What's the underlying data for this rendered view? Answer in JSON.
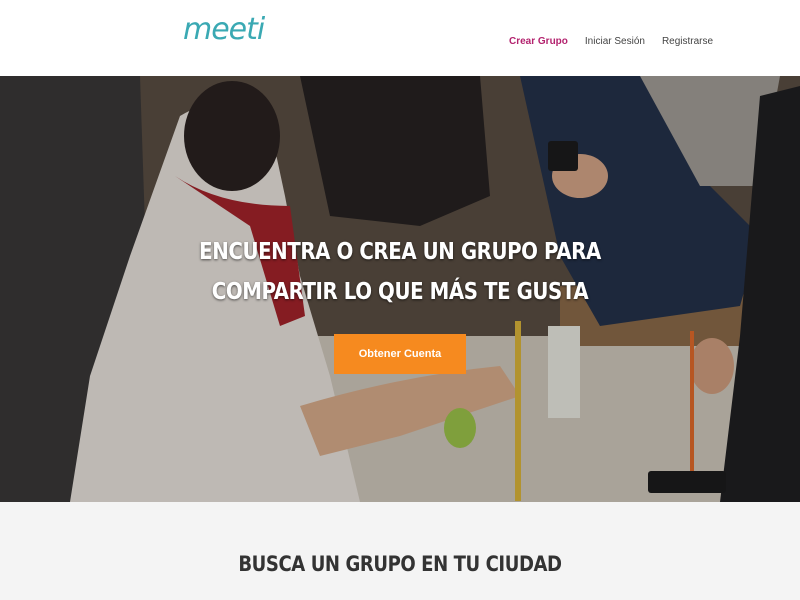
{
  "header": {
    "logo": "meeti",
    "nav": [
      {
        "label": "Crear Grupo",
        "active": true
      },
      {
        "label": "Iniciar Sesión",
        "active": false
      },
      {
        "label": "Registrarse",
        "active": false
      }
    ]
  },
  "hero": {
    "title_line1": "ENCUENTRA O CREA UN GRUPO PARA",
    "title_line2": "COMPARTIR LO QUE MÁS TE GUSTA",
    "cta_label": "Obtener Cuenta"
  },
  "search_section": {
    "title": "BUSCA UN GRUPO EN TU CIUDAD"
  },
  "colors": {
    "logo": "#3aa9b3",
    "nav_active": "#b3226e",
    "cta": "#f68a1f",
    "section_bg": "#f4f4f4"
  }
}
